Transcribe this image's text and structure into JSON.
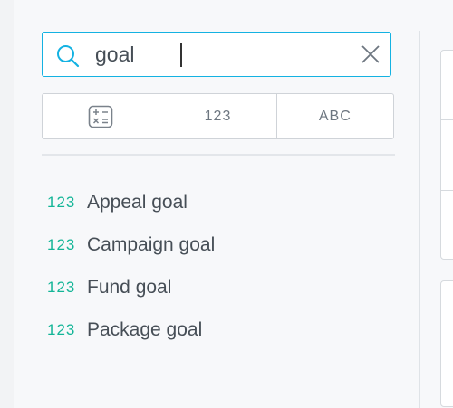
{
  "search": {
    "value": "goal",
    "placeholder": ""
  },
  "filters": [
    {
      "label": "",
      "icon": "calculator-icon"
    },
    {
      "label": "123",
      "icon": ""
    },
    {
      "label": "ABC",
      "icon": ""
    }
  ],
  "results": [
    {
      "type": "123",
      "label": "Appeal goal"
    },
    {
      "type": "123",
      "label": "Campaign goal"
    },
    {
      "type": "123",
      "label": "Fund goal"
    },
    {
      "type": "123",
      "label": "Package goal"
    }
  ],
  "colors": {
    "accent": "#14b2e2",
    "metric_badge": "#13b597",
    "text": "#464e56"
  }
}
